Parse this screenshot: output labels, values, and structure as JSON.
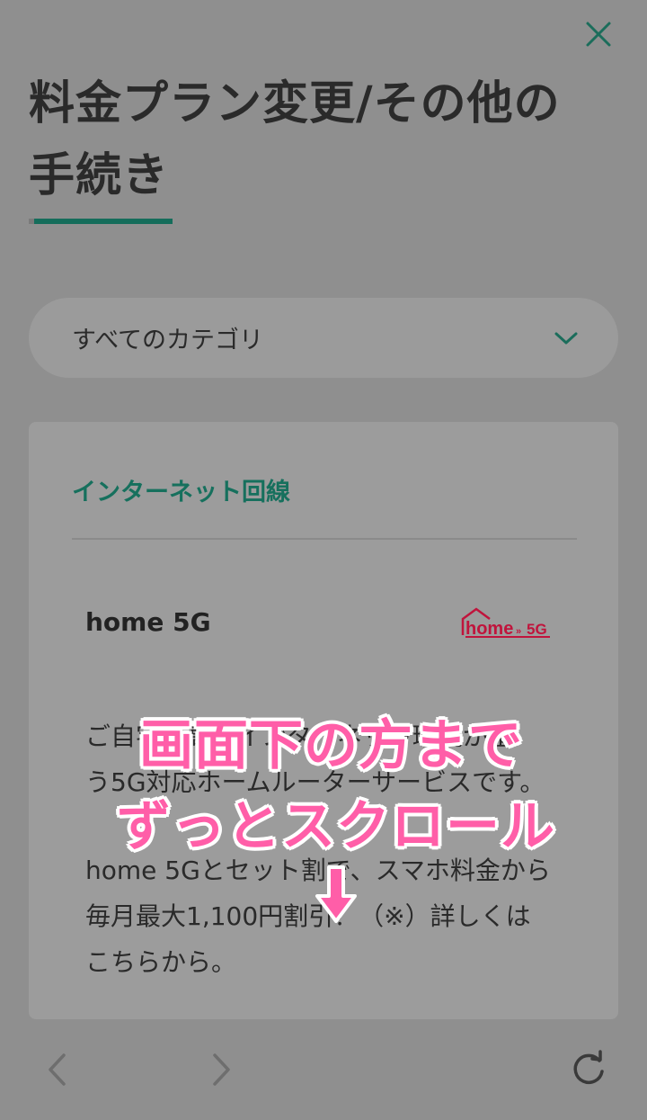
{
  "page": {
    "title_line1": "料金プラン変更/その他の",
    "title_line2": "手続き"
  },
  "category_select": {
    "selected": "すべてのカテゴリ"
  },
  "section": {
    "heading": "インターネット回線",
    "service_name": "home 5G",
    "logo_text": "home 5G",
    "desc1_line1": "ご自宅に高速インターネット環境が整",
    "desc1_line2": "う5G対応ホームルーターサービスです。",
    "desc2_line1": "home 5Gとセット割で、スマホ料金から",
    "desc2_line2": "毎月最大1,100円割引！（※）詳しくは",
    "desc2_line3": "こちらから。"
  },
  "overlay": {
    "line1": "画面下の方まで",
    "line2": "ずっとスクロール"
  },
  "colors": {
    "accent": "#156d5b",
    "overlay_pink": "#ff5ea8",
    "logo_red": "#c0143c"
  },
  "icons": {
    "close": "close-icon",
    "dropdown": "chevron-down-icon",
    "back": "chevron-left-icon",
    "forward": "chevron-right-icon",
    "reload": "reload-icon",
    "arrow": "arrow-down-icon"
  }
}
